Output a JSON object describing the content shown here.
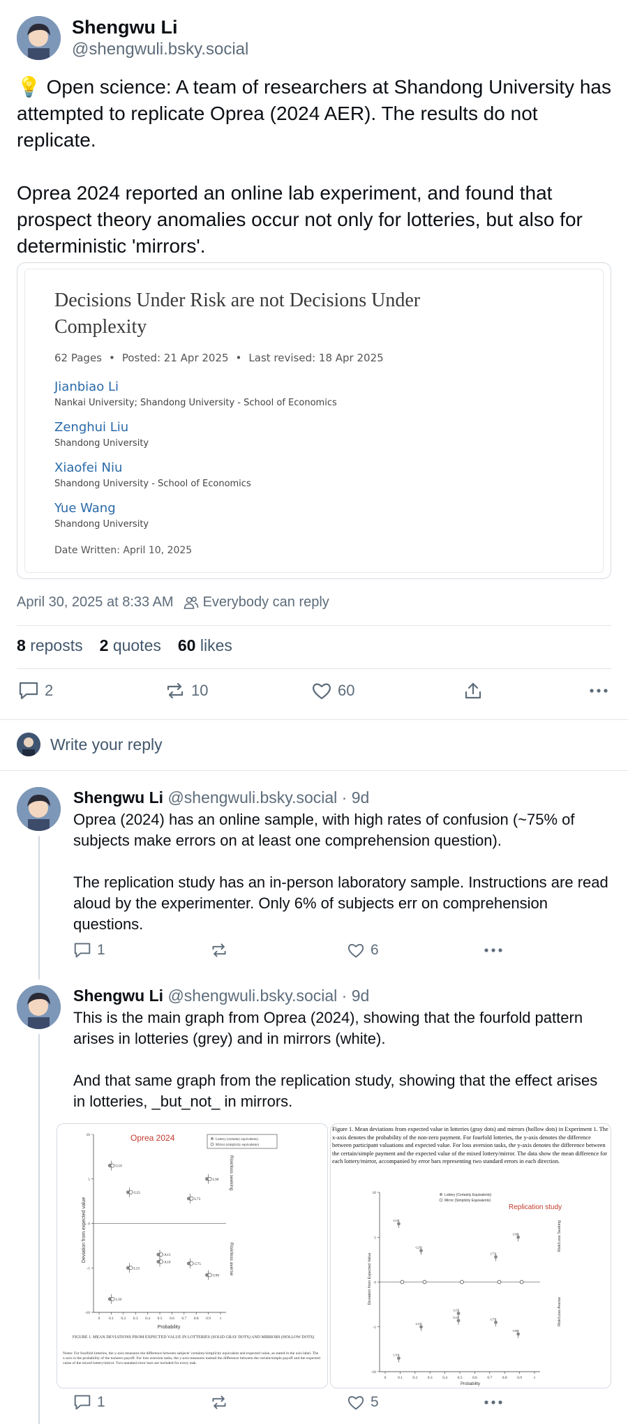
{
  "main_post": {
    "author_name": "Shengwu Li",
    "author_handle": "@shengwuli.bsky.social",
    "text": "💡 Open science: A team of researchers at Shandong University has attempted to replicate Oprea (2024 AER). The results do not replicate.\n\nOprea 2024 reported an online lab experiment, and found that prospect theory anomalies occur not only for lotteries, but also for deterministic 'mirrors'."
  },
  "embed": {
    "title": "Decisions Under Risk are not Decisions Under Complexity",
    "pages": "62 Pages",
    "posted": "Posted: 21 Apr 2025",
    "revised": "Last revised: 18 Apr 2025",
    "authors": [
      {
        "name": "Jianbiao Li",
        "aff": "Nankai University; Shandong University - School of Economics"
      },
      {
        "name": "Zenghui Liu",
        "aff": "Shandong University"
      },
      {
        "name": "Xiaofei Niu",
        "aff": "Shandong University - School of Economics"
      },
      {
        "name": "Yue Wang",
        "aff": "Shandong University"
      }
    ],
    "date_written": "Date Written: April 10, 2025"
  },
  "meta": {
    "timestamp": "April 30, 2025 at 8:33 AM",
    "reply_setting": "Everybody can reply"
  },
  "stats": {
    "reposts_count": "8",
    "reposts_label": "reposts",
    "quotes_count": "2",
    "quotes_label": "quotes",
    "likes_count": "60",
    "likes_label": "likes"
  },
  "actions": {
    "replies": "2",
    "reposts": "10",
    "likes": "60"
  },
  "reply_prompt": "Write your reply",
  "replies": [
    {
      "author_name": "Shengwu Li",
      "handle_time": "@shengwuli.bsky.social · 9d",
      "text": "Oprea (2024) has an online sample, with high rates of confusion (~75% of subjects make errors on at least one comprehension question).\n\nThe replication study has an in-person laboratory sample. Instructions are read aloud by the experimenter. Only 6% of subjects err on comprehension questions.",
      "reply_count": "1",
      "repost_count": "",
      "like_count": "6"
    },
    {
      "author_name": "Shengwu Li",
      "handle_time": "@shengwuli.bsky.social · 9d",
      "text": "This is the main graph from Oprea (2024), showing that the fourfold pattern arises in lotteries (grey) and in mirrors (white).\n\nAnd that same graph from the replication study, showing that the effect arises in lotteries, _but_not_ in mirrors.",
      "reply_count": "1",
      "repost_count": "",
      "like_count": "5"
    }
  ],
  "figure_left": {
    "label": "Oprea 2024",
    "legend_1": "Lottery (certainty equivalents)",
    "legend_2": "Mirror (simplicity equivalents)",
    "ylabel": "Deviation from expected value",
    "xlabel": "Probability",
    "right_top": "Risk/loss seeking",
    "right_bottom": "Risk/loss averse",
    "caption": "Figure 1. Mean Deviations from Expected Value in Lotteries (Solid Gray Dots) and Mirrors (Hollow Dots)",
    "notes": "Notes: For fourfold lotteries, the y-axis measures the difference between subjects' certainty/simplicity equivalent and expected value, as stated in the axis label. The x-axis is the probability of the nonzero payoff. For loss aversion tasks, the y-axis measures instead the difference between the certain/simple payoff and the expected value of the mixed lottery/mirror. Two-standard error bars are included for every task.",
    "yticks": [
      "10",
      "5",
      "0",
      "-5",
      "-10"
    ],
    "xticks": [
      "0",
      "0.1",
      "0.2",
      "0.3",
      "0.4",
      "0.5",
      "0.6",
      "0.7",
      "0.8",
      "0.9",
      "1"
    ],
    "points": [
      {
        "label": "G10",
        "x": 0.1,
        "y": 6.5
      },
      {
        "label": "G25",
        "x": 0.25,
        "y": 3.5
      },
      {
        "label": "L75",
        "x": 0.75,
        "y": 2.8
      },
      {
        "label": "L90",
        "x": 0.9,
        "y": 5.0
      },
      {
        "label": "L25",
        "x": 0.25,
        "y": -5.0
      },
      {
        "label": "L10",
        "x": 0.1,
        "y": -8.5
      },
      {
        "label": "A10",
        "x": 0.5,
        "y": -4.3
      },
      {
        "label": "A15",
        "x": 0.5,
        "y": -3.5
      },
      {
        "label": "G75",
        "x": 0.75,
        "y": -4.5
      },
      {
        "label": "G90",
        "x": 0.9,
        "y": -5.8
      }
    ]
  },
  "figure_right": {
    "header": "Figure 1. Mean deviations from expected value in lotteries (gray dots) and mirrors (hollow dots) in Experiment 1. The x-axis denotes the probability of the non-zero payment. For fourfold lotteries, the y-axis denotes the difference between participant valuations and expected value. For loss aversion tasks, the y-axis denotes the difference between the certain/simple payment and the expected value of the mixed lottery/mirror. The data show the mean difference for each lottery/mirror, accompanied by error bars representing two standard errors in each direction.",
    "label": "Replication study",
    "legend_1": "Lottery (Certainty Equivalents)",
    "legend_2": "Mirror (Simplicity Equivalents)",
    "ylabel": "Deviation from Expected Value",
    "xlabel": "Probability",
    "right_top": "Risk/Loss Seeking",
    "right_bottom": "Risk/Loss Averse",
    "yticks": [
      "10",
      "5",
      "0",
      "-5",
      "-10"
    ],
    "xticks": [
      "0",
      "0.1",
      "0.2",
      "0.3",
      "0.4",
      "0.5",
      "0.6",
      "0.7",
      "0.8",
      "0.9",
      "1"
    ]
  },
  "colors": {
    "accent_red": "#c0392b",
    "link_blue": "#2a6aa8",
    "muted": "#5d6c7a"
  }
}
